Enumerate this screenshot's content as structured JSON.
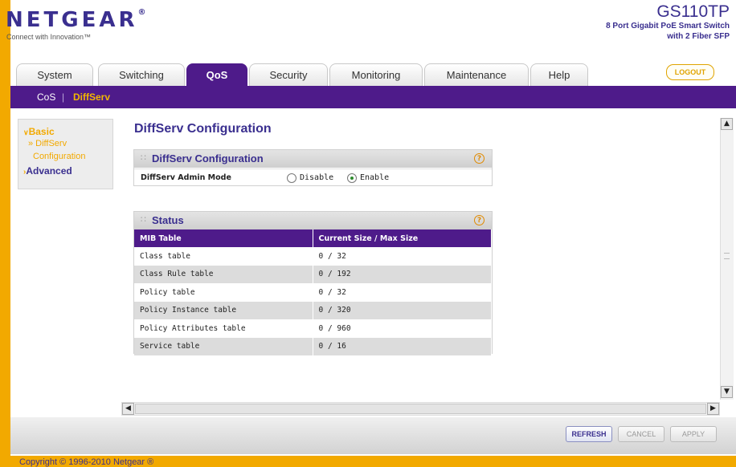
{
  "header": {
    "logo": "NETGEAR",
    "logo_mark": "®",
    "tagline": "Connect with Innovation™",
    "model": "GS110TP",
    "model_desc_line1": "8 Port Gigabit PoE Smart Switch",
    "model_desc_line2": "with 2 Fiber SFP"
  },
  "tabs": [
    {
      "label": "System"
    },
    {
      "label": "Switching"
    },
    {
      "label": "QoS"
    },
    {
      "label": "Security"
    },
    {
      "label": "Monitoring"
    },
    {
      "label": "Maintenance"
    },
    {
      "label": "Help"
    }
  ],
  "active_tab": "QoS",
  "logout_label": "LOGOUT",
  "subnav": {
    "items": [
      "CoS",
      "DiffServ"
    ],
    "separator": "|",
    "active": "DiffServ"
  },
  "sidebar": {
    "basic": "Basic",
    "diffserv_line1": "» DiffServ",
    "diffserv_line2": "Configuration",
    "advanced": "Advanced"
  },
  "page_title": "DiffServ Configuration",
  "config_box": {
    "title": "DiffServ Configuration",
    "help": "?",
    "row_label": "DiffServ Admin Mode",
    "options": [
      "Disable",
      "Enable"
    ],
    "selected": "Enable"
  },
  "status_box": {
    "title": "Status",
    "help": "?",
    "columns": [
      "MIB Table",
      "Current Size / Max Size"
    ],
    "rows": [
      [
        "Class table",
        "0 / 32"
      ],
      [
        "Class Rule table",
        "0 / 192"
      ],
      [
        "Policy table",
        "0 / 32"
      ],
      [
        "Policy Instance table",
        "0 / 320"
      ],
      [
        "Policy Attributes table",
        "0 / 960"
      ],
      [
        "Service table",
        "0 / 16"
      ]
    ]
  },
  "buttons": {
    "refresh": "REFRESH",
    "cancel": "CANCEL",
    "apply": "APPLY"
  },
  "footer": {
    "copyright": "Copyright © 1996-2010 Netgear ®"
  },
  "colors": {
    "brand_purple": "#4e1b8a",
    "accent_orange": "#f2a900",
    "title_blue": "#3a2f8f"
  }
}
